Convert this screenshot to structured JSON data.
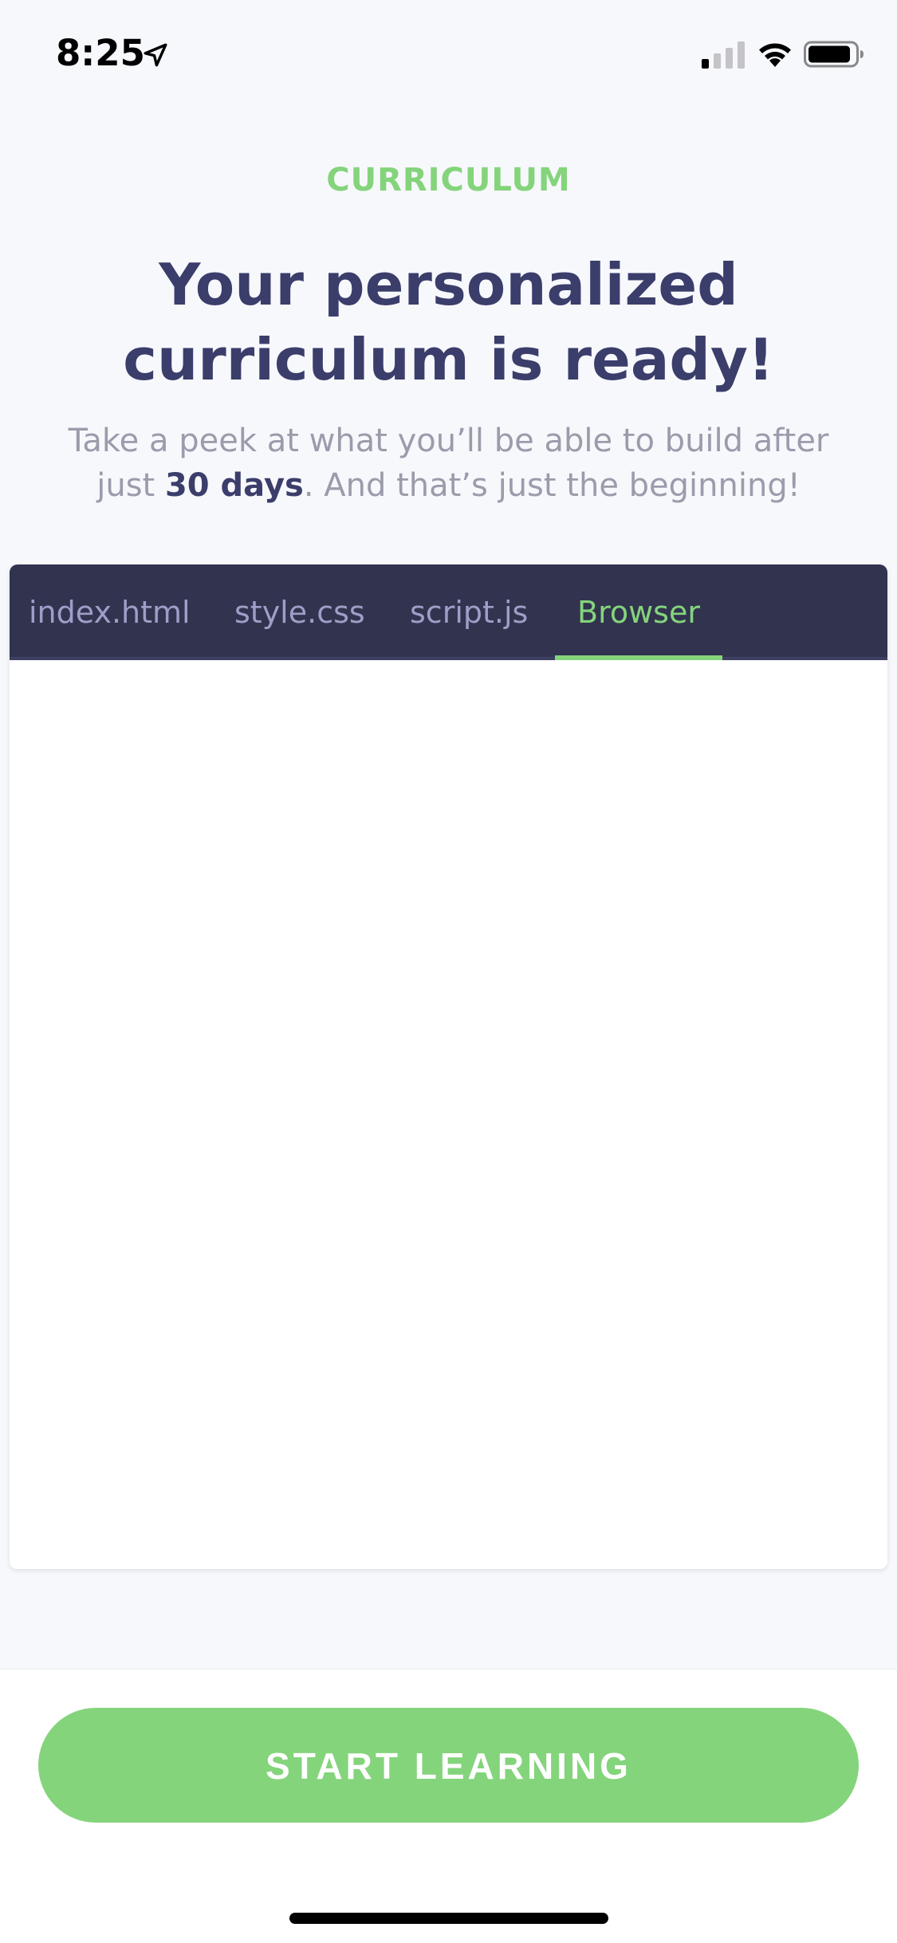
{
  "status_bar": {
    "time": "8:25"
  },
  "header": {
    "eyebrow": "CURRICULUM",
    "headline": "Your personalized curriculum is ready!",
    "subtitle_prefix": "Take a peek at what you’ll be able to build after just ",
    "subtitle_bold": "30 days",
    "subtitle_suffix": ". And that’s just the beginning!"
  },
  "panel": {
    "tabs": [
      {
        "label": "index.html",
        "active": false
      },
      {
        "label": "style.css",
        "active": false
      },
      {
        "label": "script.js",
        "active": false
      },
      {
        "label": "Browser",
        "active": true
      }
    ]
  },
  "footer": {
    "cta_label": "START LEARNING"
  },
  "colors": {
    "accent": "#84d47c",
    "heading": "#3b3d6b",
    "muted": "#9a9cab",
    "tab_bar": "#32334f",
    "tab_inactive": "#9c9fc7",
    "background": "#f7f8fc"
  },
  "icons": [
    "location-arrow-icon",
    "cellular-signal-icon",
    "wifi-icon",
    "battery-icon"
  ]
}
